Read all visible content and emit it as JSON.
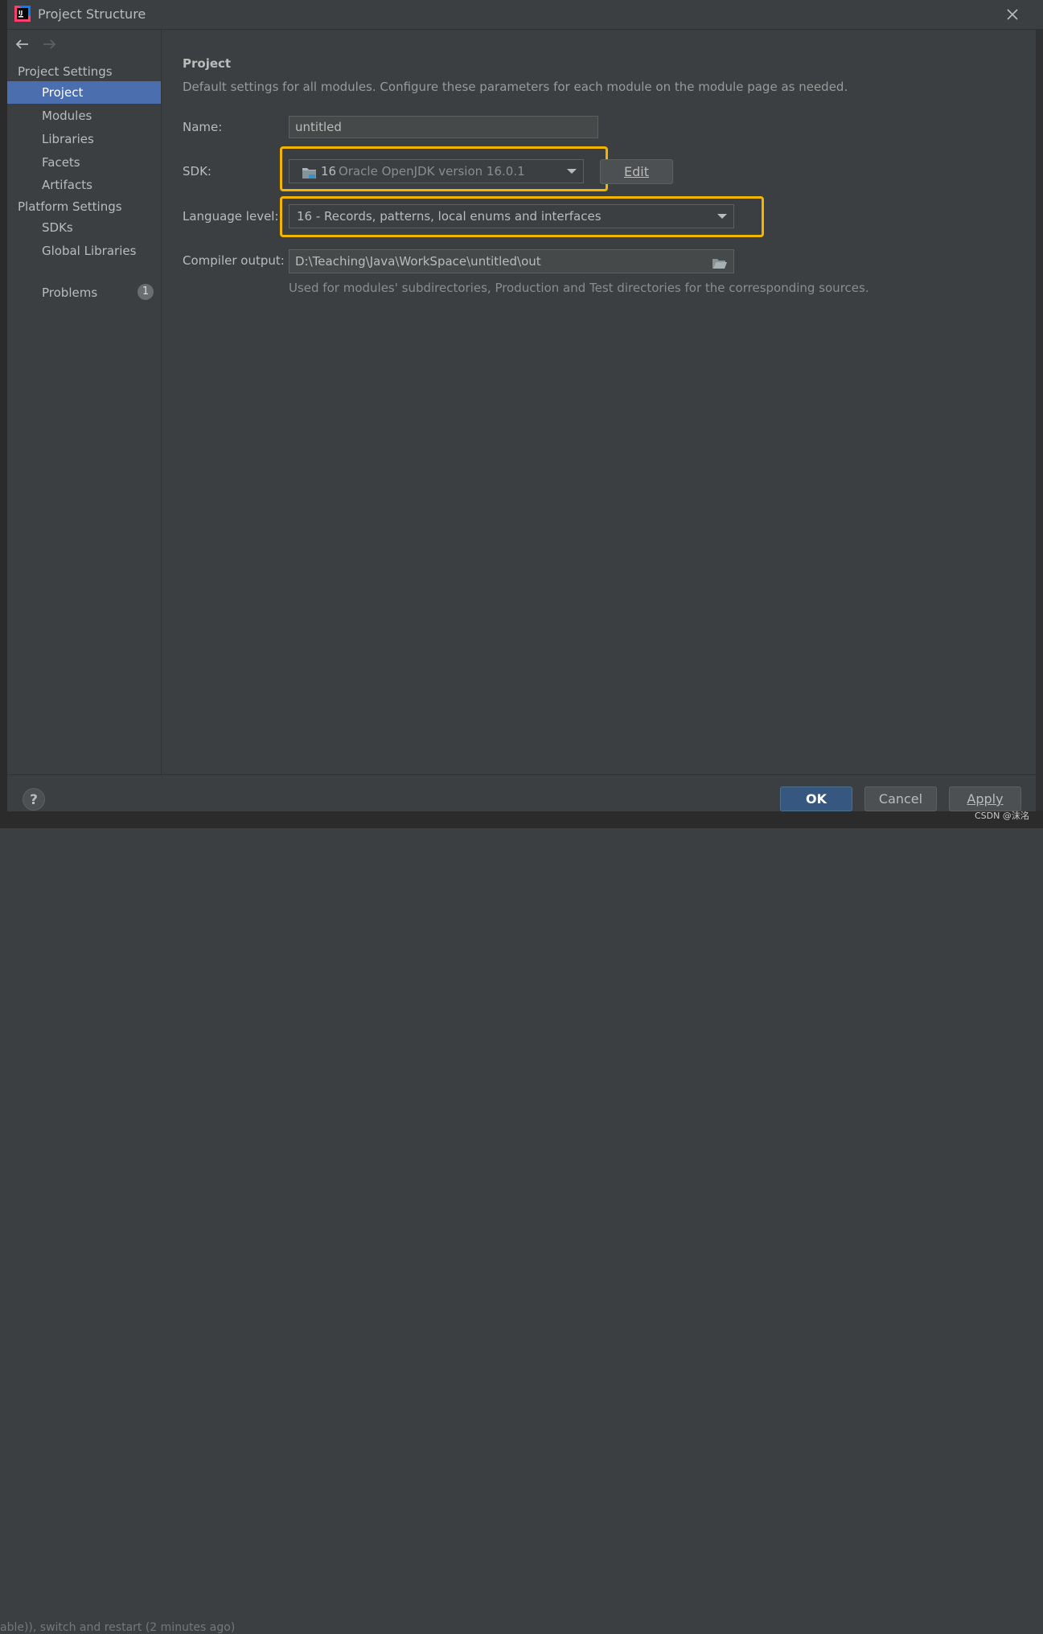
{
  "window": {
    "title": "Project Structure"
  },
  "sidebar": {
    "project_settings_header": "Project Settings",
    "platform_settings_header": "Platform Settings",
    "items": [
      {
        "label": "Project",
        "selected": true
      },
      {
        "label": "Modules"
      },
      {
        "label": "Libraries"
      },
      {
        "label": "Facets"
      },
      {
        "label": "Artifacts"
      }
    ],
    "platform_items": [
      {
        "label": "SDKs"
      },
      {
        "label": "Global Libraries"
      }
    ],
    "problems": {
      "label": "Problems",
      "count": "1"
    }
  },
  "main": {
    "title": "Project",
    "description": "Default settings for all modules. Configure these parameters for each module on the module page as needed.",
    "name_label": "Name:",
    "name_value": "untitled",
    "sdk_label": "SDK:",
    "sdk_version_num": "16",
    "sdk_value": "Oracle OpenJDK version 16.0.1",
    "edit_label": "Edit",
    "language_level_label": "Language level:",
    "language_level_value": "16 - Records, patterns, local enums and interfaces",
    "compiler_output_label": "Compiler output:",
    "compiler_output_value": "D:\\Teaching\\Java\\WorkSpace\\untitled\\out",
    "compiler_output_hint": "Used for modules' subdirectories, Production and Test directories for the corresponding sources."
  },
  "footer": {
    "help": "?",
    "ok_label": "OK",
    "cancel_label": "Cancel",
    "apply_label": "Apply"
  },
  "watermark": "CSDN @沫洺",
  "background_text": "able)), switch and restart (2 minutes ago)",
  "colors": {
    "highlight": "#f3b400",
    "selection": "#4b6eaf",
    "primary_button": "#365880"
  }
}
